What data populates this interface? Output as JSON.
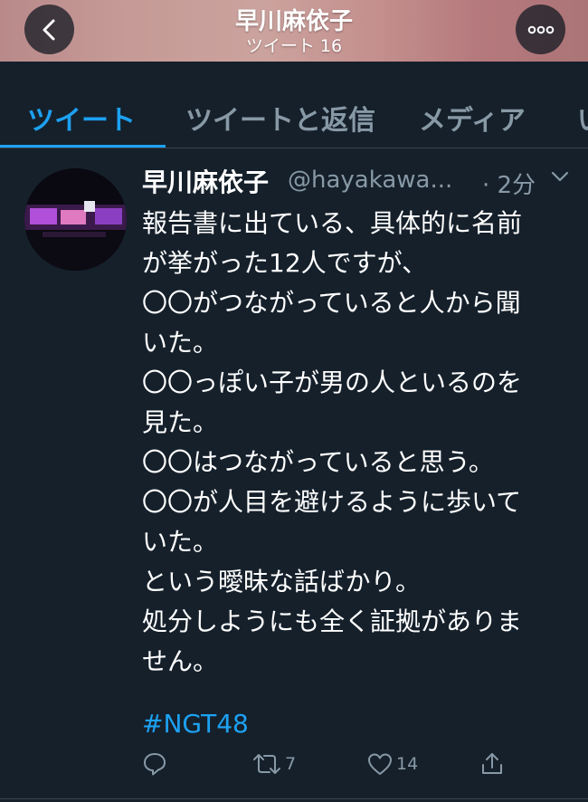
{
  "header": {
    "title": "早川麻依子",
    "subtitle": "ツイート 16"
  },
  "tabs": [
    {
      "label": "ツイート",
      "active": true
    },
    {
      "label": "ツイートと返信",
      "active": false
    },
    {
      "label": "メディア",
      "active": false
    },
    {
      "label": "い",
      "active": false
    }
  ],
  "tweet": {
    "name": "早川麻依子",
    "handle": "@hayakawa...",
    "time": "· 2分",
    "lines": [
      "報告書に出ている、具体的に名前",
      "が挙がった12人ですが、",
      "〇〇がつながっていると人から聞",
      "いた。",
      "〇〇っぽい子が男の人といるのを",
      "見た。",
      "〇〇はつながっていると思う。",
      "〇〇が人目を避けるように歩いて",
      "いた。",
      "という曖昧な話ばかり。",
      "処分しようにも全く証拠がありま",
      "せん。"
    ],
    "hashtag": "#NGT48",
    "actions": {
      "reply_count": "",
      "retweet_count": "7",
      "like_count": "14"
    }
  },
  "colors": {
    "background": "#15202b",
    "accent": "#1da1f2",
    "muted": "#8899a6",
    "divider": "#38444d"
  },
  "icons": [
    "back-arrow-icon",
    "more-icon",
    "chevron-down-icon",
    "reply-icon",
    "retweet-icon",
    "like-icon",
    "share-icon"
  ]
}
